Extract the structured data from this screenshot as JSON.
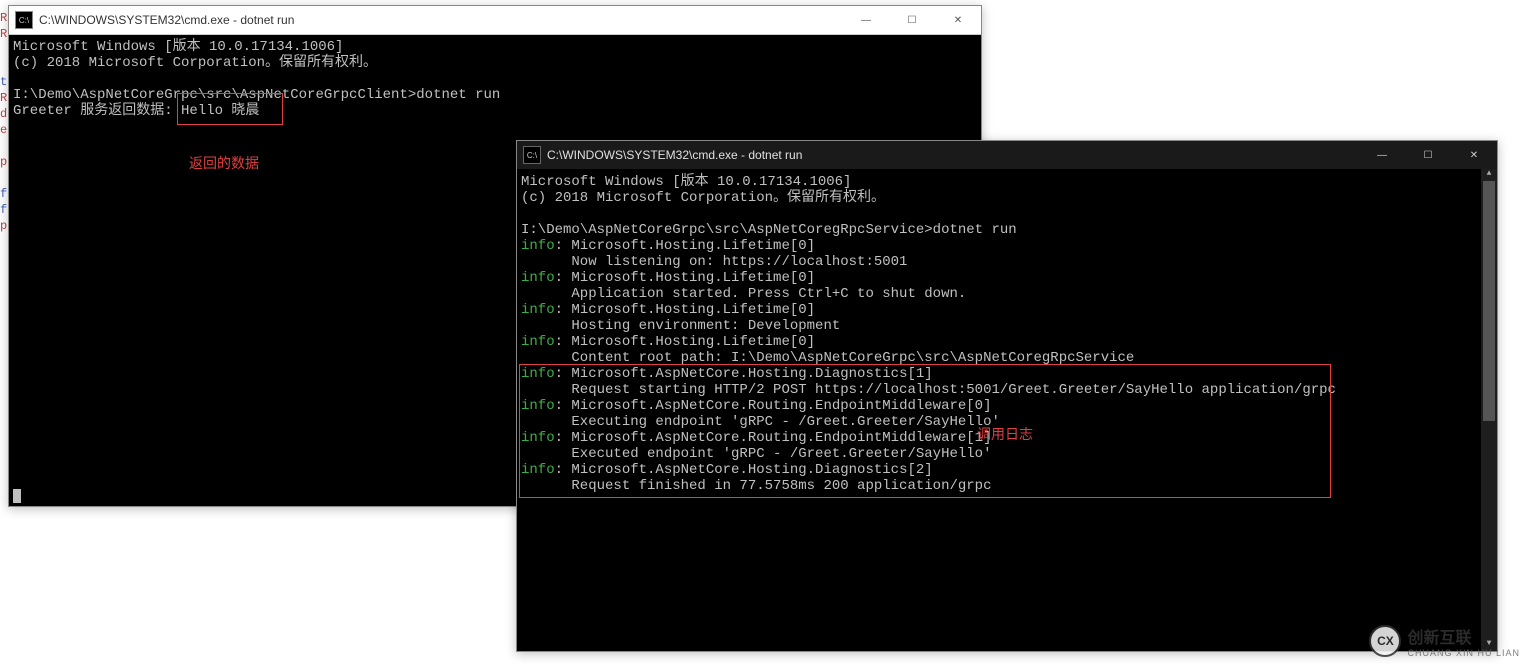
{
  "window_left": {
    "title": "C:\\WINDOWS\\SYSTEM32\\cmd.exe - dotnet  run",
    "icon_text": "C:\\",
    "lines": [
      "Microsoft Windows [版本 10.0.17134.1006]",
      "(c) 2018 Microsoft Corporation。保留所有权利。",
      "",
      "I:\\Demo\\AspNetCoreGrpc\\src\\AspNetCoreGrpcClient>dotnet run",
      "Greeter 服务返回数据: Hello 晓晨"
    ],
    "highlight_text": "Hello 晓晨",
    "annotation": "返回的数据"
  },
  "window_right": {
    "title": "C:\\WINDOWS\\SYSTEM32\\cmd.exe - dotnet  run",
    "icon_text": "C:\\",
    "header_lines": [
      "Microsoft Windows [版本 10.0.17134.1006]",
      "(c) 2018 Microsoft Corporation。保留所有权利。",
      "",
      "I:\\Demo\\AspNetCoreGrpc\\src\\AspNetCoregRpcService>dotnet run"
    ],
    "info_label": "info",
    "log_blocks": [
      {
        "title": "Microsoft.Hosting.Lifetime[0]",
        "body": "Now listening on: https://localhost:5001"
      },
      {
        "title": "Microsoft.Hosting.Lifetime[0]",
        "body": "Application started. Press Ctrl+C to shut down."
      },
      {
        "title": "Microsoft.Hosting.Lifetime[0]",
        "body": "Hosting environment: Development"
      },
      {
        "title": "Microsoft.Hosting.Lifetime[0]",
        "body": "Content root path: I:\\Demo\\AspNetCoreGrpc\\src\\AspNetCoregRpcService"
      },
      {
        "title": "Microsoft.AspNetCore.Hosting.Diagnostics[1]",
        "body": "Request starting HTTP/2 POST https://localhost:5001/Greet.Greeter/SayHello application/grpc"
      },
      {
        "title": "Microsoft.AspNetCore.Routing.EndpointMiddleware[0]",
        "body": "Executing endpoint 'gRPC - /Greet.Greeter/SayHello'"
      },
      {
        "title": "Microsoft.AspNetCore.Routing.EndpointMiddleware[1]",
        "body": "Executed endpoint 'gRPC - /Greet.Greeter/SayHello'"
      },
      {
        "title": "Microsoft.AspNetCore.Hosting.Diagnostics[2]",
        "body": "Request finished in 77.5758ms 200 application/grpc"
      }
    ],
    "annotation": "调用日志"
  },
  "gutter_letters": [
    "R",
    "R",
    "",
    "",
    "t",
    "R",
    "d",
    "e",
    "",
    "p",
    "",
    "f",
    "f",
    "p"
  ],
  "win_controls": {
    "minimize": "—",
    "maximize": "☐",
    "close": "✕"
  },
  "watermark": {
    "badge": "CX",
    "main": "创新互联",
    "sub": "CHUANG XIN HU LIAN"
  }
}
